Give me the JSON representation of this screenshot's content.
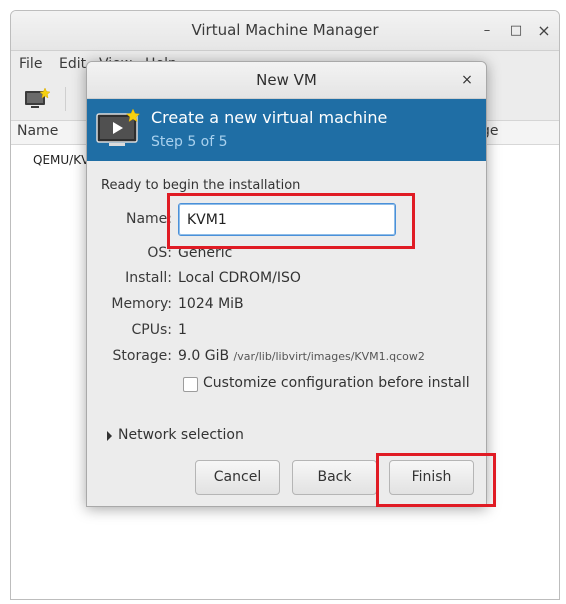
{
  "main_window": {
    "title": "Virtual Machine Manager",
    "controls": {
      "minimize": "–",
      "maximize": "□",
      "close": "×"
    },
    "menu": [
      "File",
      "Edit",
      "View",
      "Help"
    ],
    "columns": {
      "name": "Name",
      "usage": "ge"
    },
    "connection_row": "QEMU/KV"
  },
  "dialog": {
    "title": "New VM",
    "close": "×",
    "banner": {
      "title": "Create a new virtual machine",
      "step": "Step 5 of 5",
      "color": "#1f6ea5"
    },
    "ready_text": "Ready to begin the installation",
    "fields": {
      "name_label": "Name:",
      "name_value": "KVM1",
      "os_label": "OS:",
      "os_value": "Generic",
      "install_label": "Install:",
      "install_value": "Local CDROM/ISO",
      "memory_label": "Memory:",
      "memory_value": "1024 MiB",
      "cpus_label": "CPUs:",
      "cpus_value": "1",
      "storage_label": "Storage:",
      "storage_value": "9.0 GiB",
      "storage_path": "/var/lib/libvirt/images/KVM1.qcow2"
    },
    "customize_label": "Customize configuration before install",
    "customize_checked": false,
    "network_label": "Network selection",
    "buttons": {
      "cancel": "Cancel",
      "back": "Back",
      "finish": "Finish"
    }
  },
  "highlight_color": "#e01b24"
}
